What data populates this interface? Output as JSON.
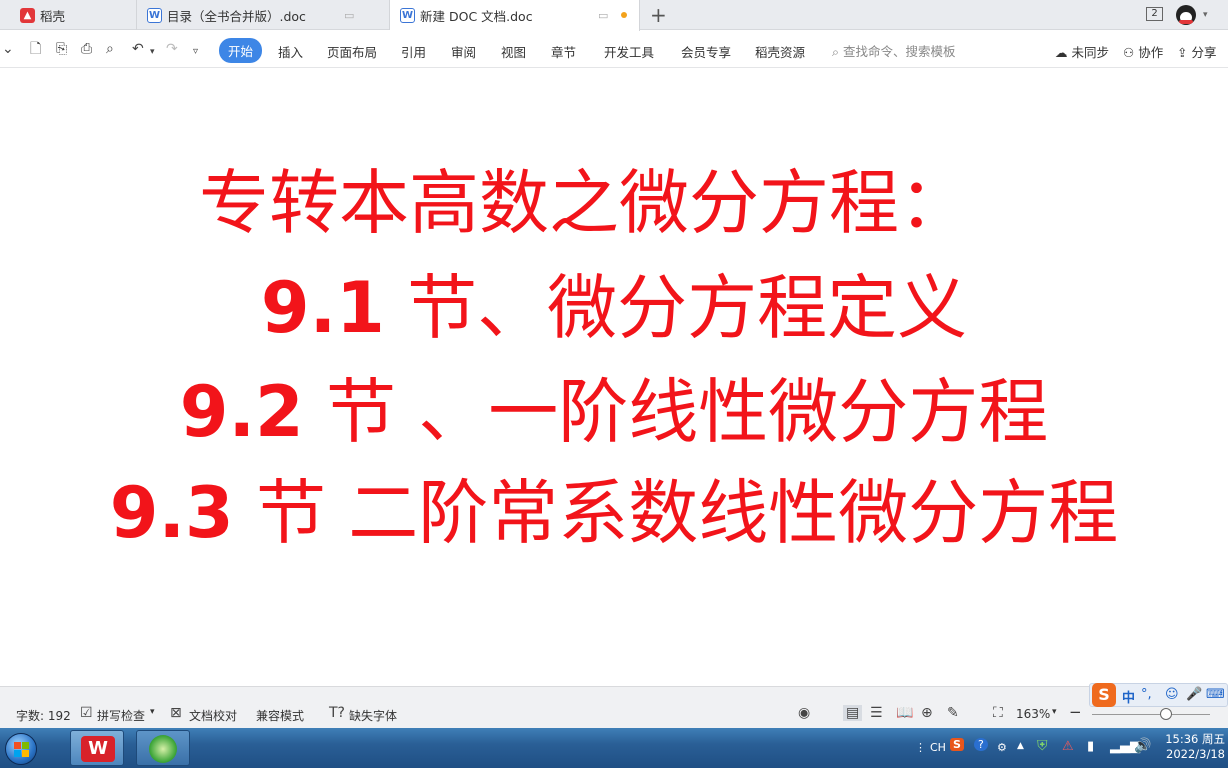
{
  "tabs": [
    {
      "label": "稻壳",
      "icon": "docer-icon"
    },
    {
      "label": "目录（全书合并版）.doc",
      "icon": "wps-writer-icon"
    },
    {
      "label": "新建 DOC 文档.doc",
      "icon": "wps-writer-icon",
      "active": true
    }
  ],
  "tabbar": {
    "window_count": "2"
  },
  "menu": {
    "items": [
      "开始",
      "插入",
      "页面布局",
      "引用",
      "审阅",
      "视图",
      "章节",
      "开发工具",
      "会员专享",
      "稻壳资源"
    ],
    "active": "开始",
    "search_placeholder": "查找命令、搜索模板",
    "sync_label": "未同步",
    "collab_label": "协作",
    "share_label": "分享"
  },
  "document": {
    "line1": "专转本高数之微分方程：",
    "line2_num": "9.1",
    "line2_text": " 节、微分方程定义",
    "line3_num": "9.2",
    "line3_text": " 节 、一阶线性微分方程",
    "line4_num": "9.3",
    "line4_text": " 节  二阶常系数线性微分方程",
    "text_color": "#f2141a"
  },
  "status": {
    "word_count": "字数: 192",
    "spell_check": "拼写检查",
    "proofread": "文档校对",
    "compat_mode": "兼容模式",
    "missing_fonts": "缺失字体",
    "zoom": "163%",
    "zoom_fraction": 0.63
  },
  "ime": {
    "lang": "中",
    "punct": "°,"
  },
  "taskbar": {
    "tray_lang": "CH",
    "time": "15:36 周五",
    "date": "2022/3/18"
  }
}
